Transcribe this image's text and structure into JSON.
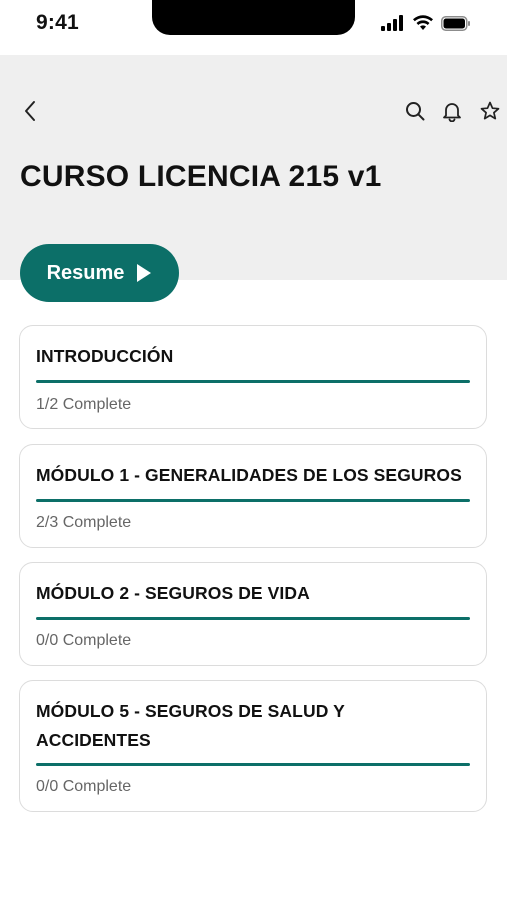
{
  "status": {
    "time": "9:41"
  },
  "header": {
    "title": "CURSO LICENCIA 215 v1"
  },
  "icons": {
    "back": "chevron-left-icon",
    "search": "search-icon",
    "bell": "bell-icon",
    "star": "star-icon"
  },
  "resume": {
    "label": "Resume"
  },
  "colors": {
    "accent": "#0c6f68",
    "header_bg": "#efefef"
  },
  "modules": [
    {
      "title": "INTRODUCCIÓN",
      "progress": "1/2 Complete"
    },
    {
      "title": "MÓDULO 1 - GENERALIDADES DE LOS SEGUROS",
      "progress": "2/3 Complete"
    },
    {
      "title": "MÓDULO 2 - SEGUROS DE VIDA",
      "progress": "0/0 Complete"
    },
    {
      "title": "MÓDULO 5 - SEGUROS DE SALUD Y ACCIDENTES",
      "progress": "0/0 Complete"
    }
  ]
}
